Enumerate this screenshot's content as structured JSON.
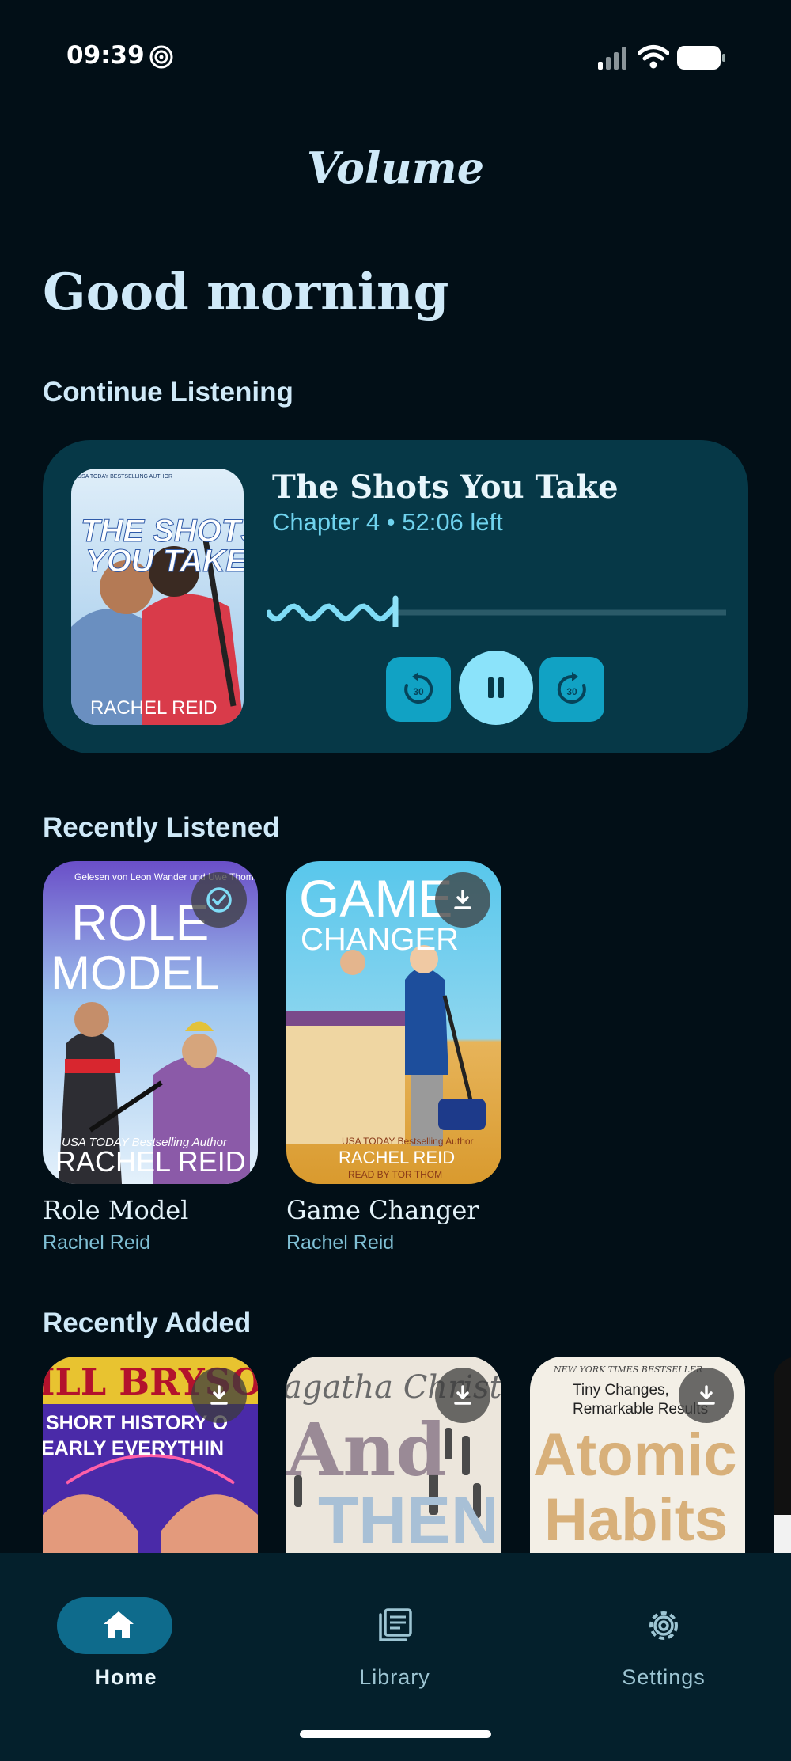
{
  "status": {
    "time": "09:39"
  },
  "app": {
    "title": "Volume",
    "greeting": "Good morning"
  },
  "sections": {
    "continue": "Continue Listening",
    "recent": "Recently Listened",
    "added": "Recently Added"
  },
  "now_playing": {
    "title": "The Shots You Take",
    "subtitle": "Chapter 4 • 52:06 left",
    "progress": 0.28,
    "rewind_label": "30",
    "forward_label": "30",
    "cover": {
      "line1": "THE SHOTS",
      "line2": "YOU TAKE",
      "author": "RACHEL REID",
      "blurb": "USA TODAY BESTSELLING AUTHOR"
    }
  },
  "recent": [
    {
      "title": "Role Model",
      "author": "Rachel Reid",
      "cover_line1": "ROLE",
      "cover_line2": "MODEL",
      "cover_author": "RACHEL REID",
      "cover_top": "Gelesen von Leon Wander und Uwe Thoma",
      "cover_blurb": "USA TODAY Bestselling Author",
      "badge": "downloaded"
    },
    {
      "title": "Game Changer",
      "author": "Rachel Reid",
      "cover_line1": "GAME",
      "cover_line2": "CHANGER",
      "cover_author": "RACHEL REID",
      "cover_narrator": "READ BY TOR THOM",
      "cover_blurb": "USA TODAY Bestselling Author",
      "badge": "download"
    }
  ],
  "added": [
    {
      "cover_line1": "ILL BRYSO",
      "cover_line2": "SHORT HISTORY O",
      "cover_line3": "EARLY EVERYTHIN"
    },
    {
      "cover_line1": "agatha Christ",
      "cover_line2": "And",
      "cover_line3": "THEN"
    },
    {
      "cover_top": "NEW YORK TIMES BESTSELLER",
      "cover_line1": "Tiny Changes,",
      "cover_line2": "Remarkable Results",
      "cover_line3": "Atomic",
      "cover_line4": "Habits"
    }
  ],
  "nav": [
    {
      "label": "Home",
      "icon": "home-icon",
      "active": true
    },
    {
      "label": "Library",
      "icon": "library-icon",
      "active": false
    },
    {
      "label": "Settings",
      "icon": "gear-icon",
      "active": false
    }
  ]
}
